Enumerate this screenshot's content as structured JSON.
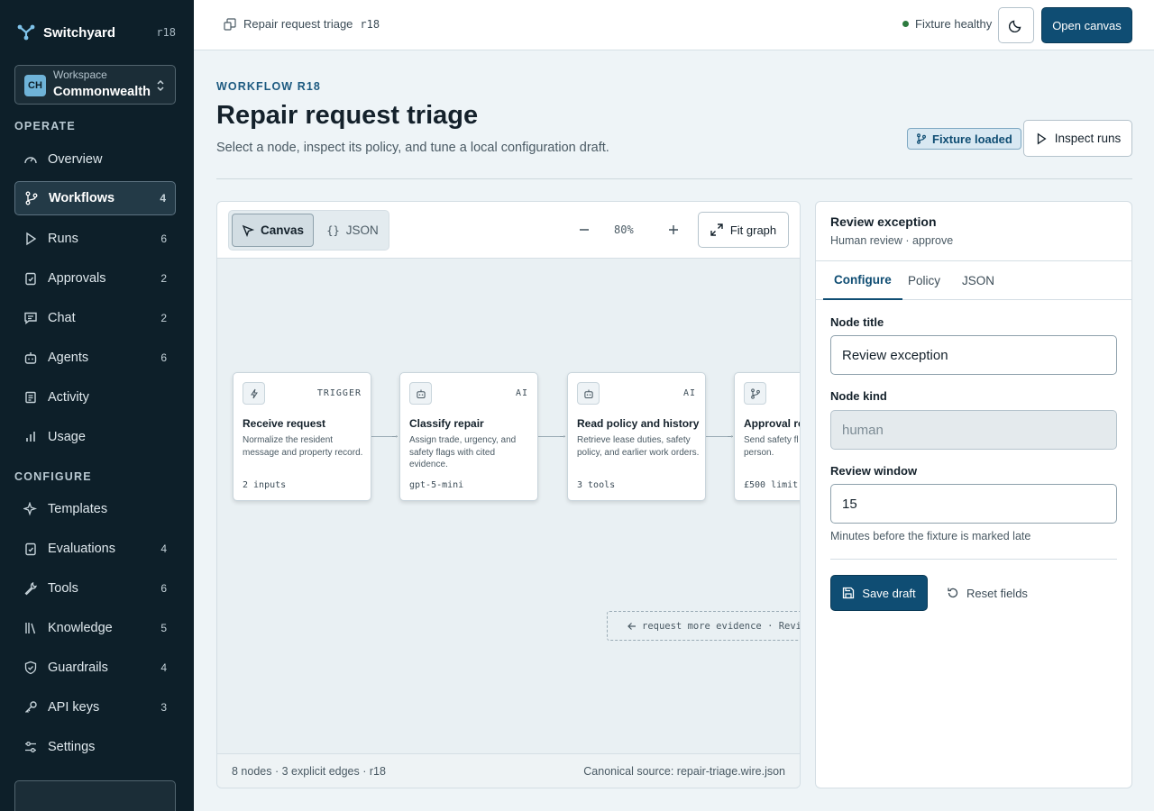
{
  "app": {
    "name": "Switchyard",
    "version": "r18"
  },
  "workspace": {
    "initials": "CH",
    "label": "Workspace",
    "name": "Commonwealth"
  },
  "sidebar": {
    "sections": [
      "OPERATE",
      "CONFIGURE"
    ],
    "operate": [
      {
        "label": "Overview",
        "count": "",
        "icon": "gauge-icon"
      },
      {
        "label": "Workflows",
        "count": "4",
        "icon": "branch-icon",
        "active": true
      },
      {
        "label": "Runs",
        "count": "6",
        "icon": "play-icon"
      },
      {
        "label": "Approvals",
        "count": "2",
        "icon": "clipboard-check-icon"
      },
      {
        "label": "Chat",
        "count": "2",
        "icon": "chat-icon"
      },
      {
        "label": "Agents",
        "count": "6",
        "icon": "bot-icon"
      },
      {
        "label": "Activity",
        "count": "",
        "icon": "activity-icon"
      },
      {
        "label": "Usage",
        "count": "",
        "icon": "bar-chart-icon"
      }
    ],
    "configure": [
      {
        "label": "Templates",
        "count": "",
        "icon": "sparkles-icon"
      },
      {
        "label": "Evaluations",
        "count": "4",
        "icon": "clipboard-check-icon"
      },
      {
        "label": "Tools",
        "count": "6",
        "icon": "wrench-icon"
      },
      {
        "label": "Knowledge",
        "count": "5",
        "icon": "library-icon"
      },
      {
        "label": "Guardrails",
        "count": "4",
        "icon": "shield-icon"
      },
      {
        "label": "API keys",
        "count": "3",
        "icon": "key-icon"
      },
      {
        "label": "Settings",
        "count": "",
        "icon": "sliders-icon"
      }
    ]
  },
  "topbar": {
    "breadcrumb": "Repair request triage",
    "breadcrumb_ver": "r18",
    "status": "Fixture healthy",
    "open_canvas": "Open canvas"
  },
  "header": {
    "eyebrow": "WORKFLOW R18",
    "title": "Repair request triage",
    "subtitle": "Select a node, inspect its policy, and tune a local configuration draft.",
    "badge": "Fixture loaded",
    "inspect_runs": "Inspect runs"
  },
  "canvas": {
    "view_canvas": "Canvas",
    "view_json": "JSON",
    "zoom": "80%",
    "fit_graph": "Fit graph",
    "nodes": [
      {
        "kind": "TRIGGER",
        "title": "Receive request",
        "desc": "Normalize the resident message and property record.",
        "meta": "2 inputs",
        "icon": "bolt-icon"
      },
      {
        "kind": "AI",
        "title": "Classify repair",
        "desc": "Assign trade, urgency, and safety flags with cited evidence.",
        "meta": "gpt-5-mini",
        "icon": "bot-icon"
      },
      {
        "kind": "AI",
        "title": "Read policy and history",
        "desc": "Retrieve lease duties, safety policy, and earlier work orders.",
        "meta": "3 tools",
        "icon": "bot-icon"
      },
      {
        "kind": "",
        "title": "Approval re",
        "desc": "Send safety fl estimates abo person.",
        "meta": "£500 limit",
        "icon": "branch-icon"
      }
    ],
    "loop_edge": "request more evidence · Review",
    "footer_left": "8 nodes · 3 explicit edges · r18",
    "footer_right": "Canonical source: repair-triage.wire.json"
  },
  "inspector": {
    "title": "Review exception",
    "subtitle": "Human review · approve",
    "tabs": [
      "Configure",
      "Policy",
      "JSON"
    ],
    "node_title_label": "Node title",
    "node_title_value": "Review exception",
    "node_kind_label": "Node kind",
    "node_kind_value": "human",
    "review_window_label": "Review window",
    "review_window_value": "15",
    "review_window_help": "Minutes before the fixture is marked late",
    "save": "Save draft",
    "reset": "Reset fields"
  }
}
